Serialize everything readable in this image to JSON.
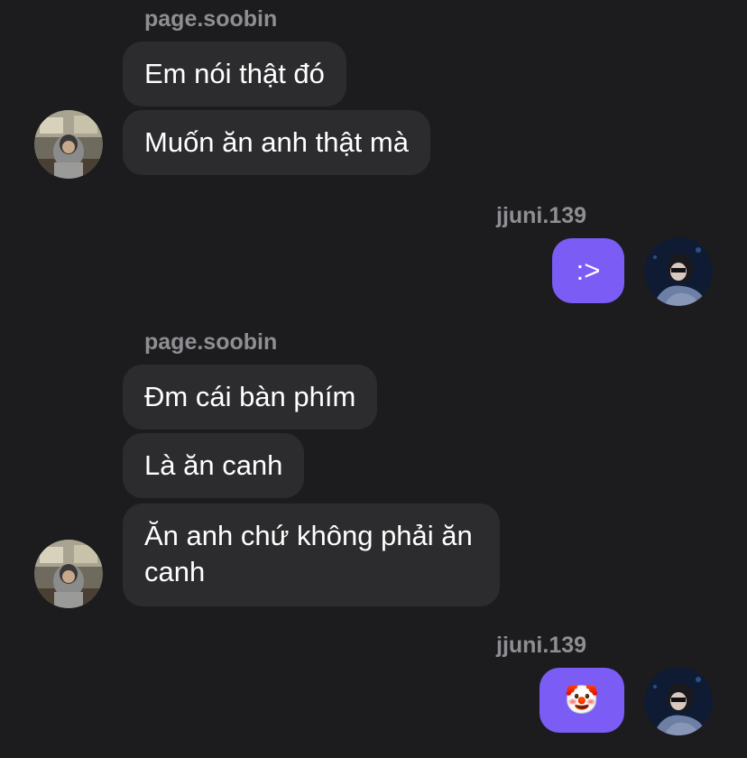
{
  "conversation": {
    "groups": [
      {
        "sender": "page.soobin",
        "messages": [
          "Em nói thật đó",
          "Muốn ăn anh thật mà"
        ]
      },
      {
        "sender": "jjuni.139",
        "messages": [
          ":>"
        ]
      },
      {
        "sender": "page.soobin",
        "messages": [
          "Đm cái bàn phím",
          "Là ăn canh",
          "Ăn anh chứ không phải ăn canh"
        ]
      },
      {
        "sender": "jjuni.139",
        "messages": [
          "🤡"
        ]
      }
    ]
  },
  "colors": {
    "background": "#1c1c1e",
    "incoming_bubble": "#2c2c2e",
    "outgoing_bubble": "#7b5cf5",
    "sender_name": "#8e8e93"
  },
  "icons": {
    "incoming_avatar": "avatar-photo-icon",
    "outgoing_avatar": "avatar-photo-icon"
  }
}
